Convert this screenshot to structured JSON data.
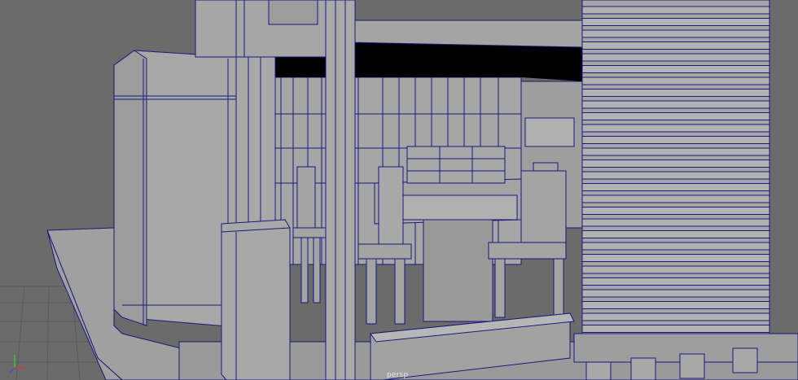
{
  "viewport": {
    "camera_label": "persp"
  },
  "gizmo": {
    "icon": "axis-gizmo-icon",
    "axis_x_color": "#d23a3a",
    "axis_y_color": "#3ac23a",
    "axis_z_color": "#3a5ad2"
  },
  "colors": {
    "background": "#6b6b6b",
    "surface": "#a4a4a4",
    "surface_dark": "#8c8c8c",
    "wire": "#1a1a7a",
    "shadow": "#000000"
  }
}
